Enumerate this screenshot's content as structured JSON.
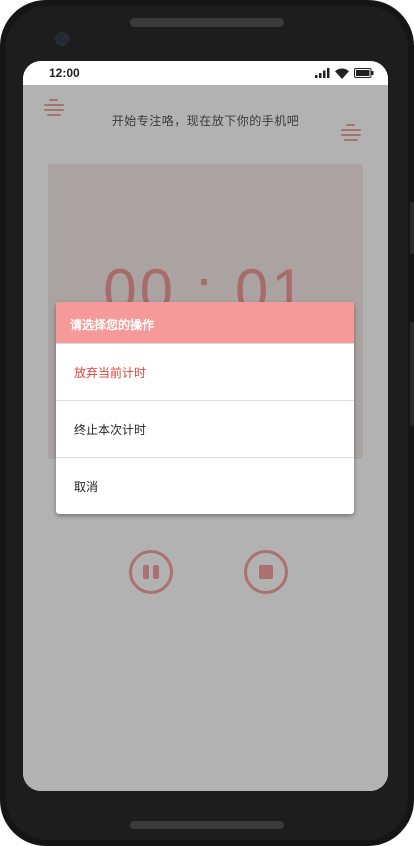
{
  "status_bar": {
    "time": "12:00",
    "icons": [
      "signal-icon",
      "wifi-icon",
      "battery-icon"
    ]
  },
  "app": {
    "subtitle": "开始专注咯，现在放下你的手机吧",
    "timer": "00 : 01",
    "controls": [
      "pause-icon",
      "stop-icon"
    ],
    "accent_color": "#f59a98"
  },
  "dialog": {
    "title": "请选择您的操作",
    "options": [
      {
        "label": "放弃当前计时",
        "color": "#e0403b"
      },
      {
        "label": "终止本次计时"
      },
      {
        "label": "取消"
      }
    ]
  }
}
